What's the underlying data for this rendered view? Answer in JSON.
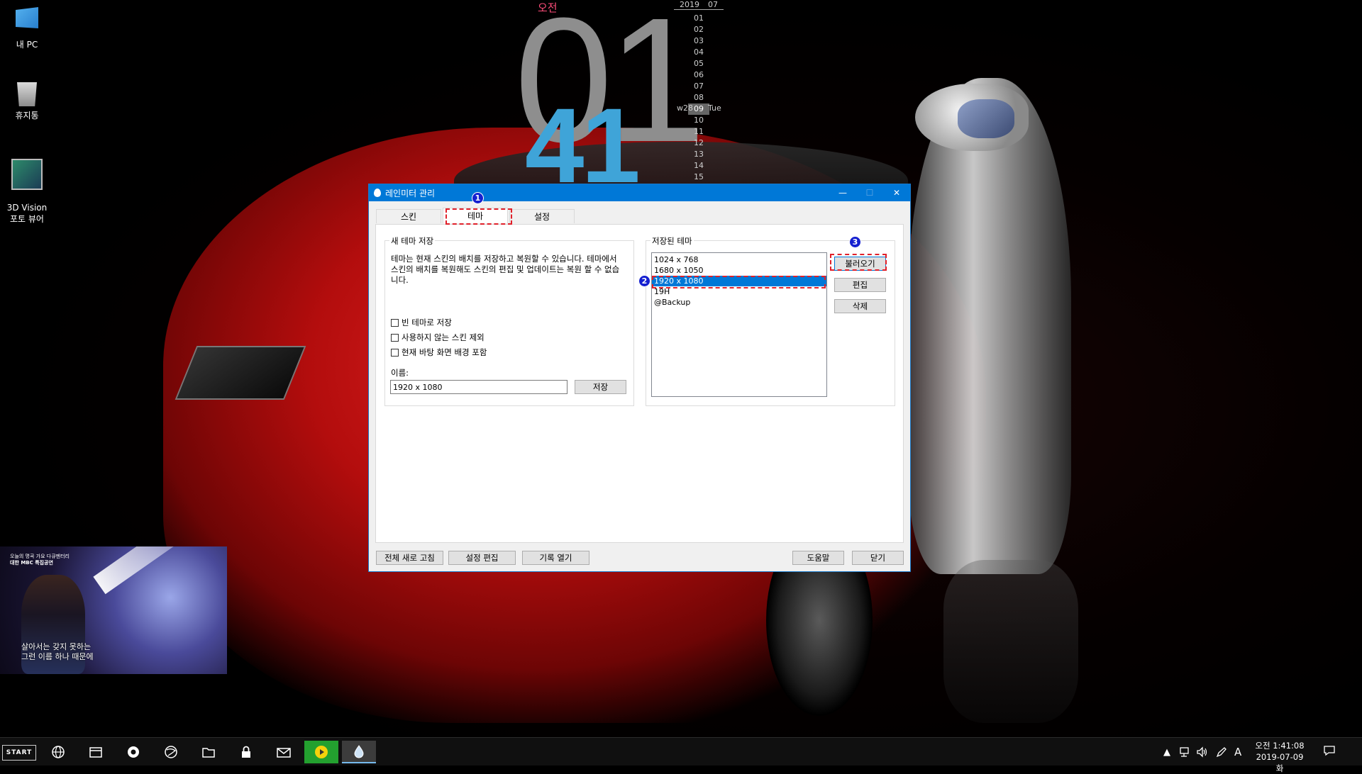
{
  "desktop": {
    "icons": [
      {
        "label": "내 PC",
        "icon": "computer-icon"
      },
      {
        "label": "휴지통",
        "icon": "recycle-bin-icon"
      },
      {
        "label": "3D Vision\n포토 뷰어",
        "icon": "3d-vision-icon"
      }
    ]
  },
  "clock_skin": {
    "ampm": "오전",
    "hour": "01",
    "minute": "41",
    "year": "2019",
    "month": "07",
    "week": "w28",
    "weekday": "Tue",
    "days": [
      "01",
      "02",
      "03",
      "04",
      "05",
      "06",
      "07",
      "08",
      "09",
      "10",
      "11",
      "12",
      "13",
      "14",
      "15"
    ],
    "today": "09"
  },
  "video": {
    "logo_line1": "오늘의 명곡 가요 다큐멘터리",
    "logo_line2": "대한 MBC 특집공연",
    "subtitle_line1": "살아서는 갖지 못하는",
    "subtitle_line2": "그런 이름 하나 때문에"
  },
  "dialog": {
    "title": "레인미터 관리",
    "minimize": "—",
    "maximize": "☐",
    "close": "✕",
    "tabs": [
      "스킨",
      "테마",
      "설정"
    ],
    "active_tab": "테마",
    "new_theme": {
      "group_title": "새 테마 저장",
      "description": "테마는 현재 스킨의 배치를 저장하고 복원할 수 있습니다. 테마에서 스킨의 배치를 복원해도 스킨의 편집 및 업데이트는 복원 할 수 없습니다.",
      "checkboxes": [
        "빈 테마로 저장",
        "사용하지 않는 스킨 제외",
        "현재 바탕 화면 배경 포함"
      ],
      "name_label": "이름:",
      "name_value": "1920 x 1080",
      "save_button": "저장"
    },
    "saved_themes": {
      "group_title": "저장된 테마",
      "items": [
        "1024 x 768",
        "1680 x 1050",
        "1920 x 1080",
        "19H",
        "@Backup"
      ],
      "selected": "1920 x 1080",
      "load_button": "불러오기",
      "edit_button": "편집",
      "delete_button": "삭제"
    },
    "footer": {
      "refresh_all": "전체 새로 고침",
      "edit_settings": "설정 편집",
      "open_log": "기록 열기",
      "help": "도움말",
      "close": "닫기"
    },
    "markers": [
      "1",
      "2",
      "3"
    ],
    "highlight_color": "#e0202a",
    "marker_color": "#1520d0"
  },
  "taskbar": {
    "start_label": "START",
    "apps": [
      "network-globe-icon",
      "file-explorer-icon",
      "media-player-icon",
      "web-browser-icon",
      "folder-icon",
      "lock-icon",
      "mail-icon",
      "kakao-app-icon",
      "rainmeter-icon"
    ],
    "tray": {
      "chevron": "▲",
      "ime": "A"
    },
    "clock_time": "오전 1:41:08",
    "clock_date": "2019-07-09 화"
  },
  "colors": {
    "accent": "#0078d7",
    "clock_hour": "#8e8e8e",
    "clock_minute": "#3fa4d8",
    "ampm": "#ff4d7a"
  }
}
